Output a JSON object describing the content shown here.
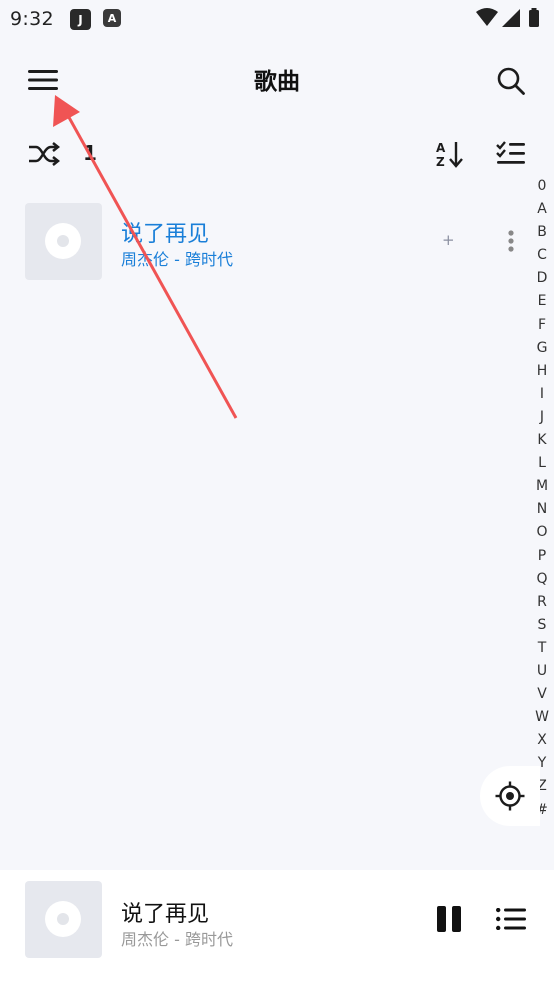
{
  "status_bar": {
    "time": "9:32",
    "app_icon_1": "J",
    "app_icon_2": "A"
  },
  "app_bar": {
    "title": "歌曲"
  },
  "toolbar": {
    "count": "1"
  },
  "songs": [
    {
      "title": "说了再见",
      "subtitle": "周杰伦 - 跨时代",
      "add_label": "+"
    }
  ],
  "alphabet": [
    "0",
    "A",
    "B",
    "C",
    "D",
    "E",
    "F",
    "G",
    "H",
    "I",
    "J",
    "K",
    "L",
    "M",
    "N",
    "O",
    "P",
    "Q",
    "R",
    "S",
    "T",
    "U",
    "V",
    "W",
    "X",
    "Y",
    "Z",
    "#"
  ],
  "mini_player": {
    "title": "说了再见",
    "subtitle": "周杰伦 - 跨时代"
  },
  "colors": {
    "accent": "#1a7fd8",
    "annotation_arrow": "#f05454"
  }
}
